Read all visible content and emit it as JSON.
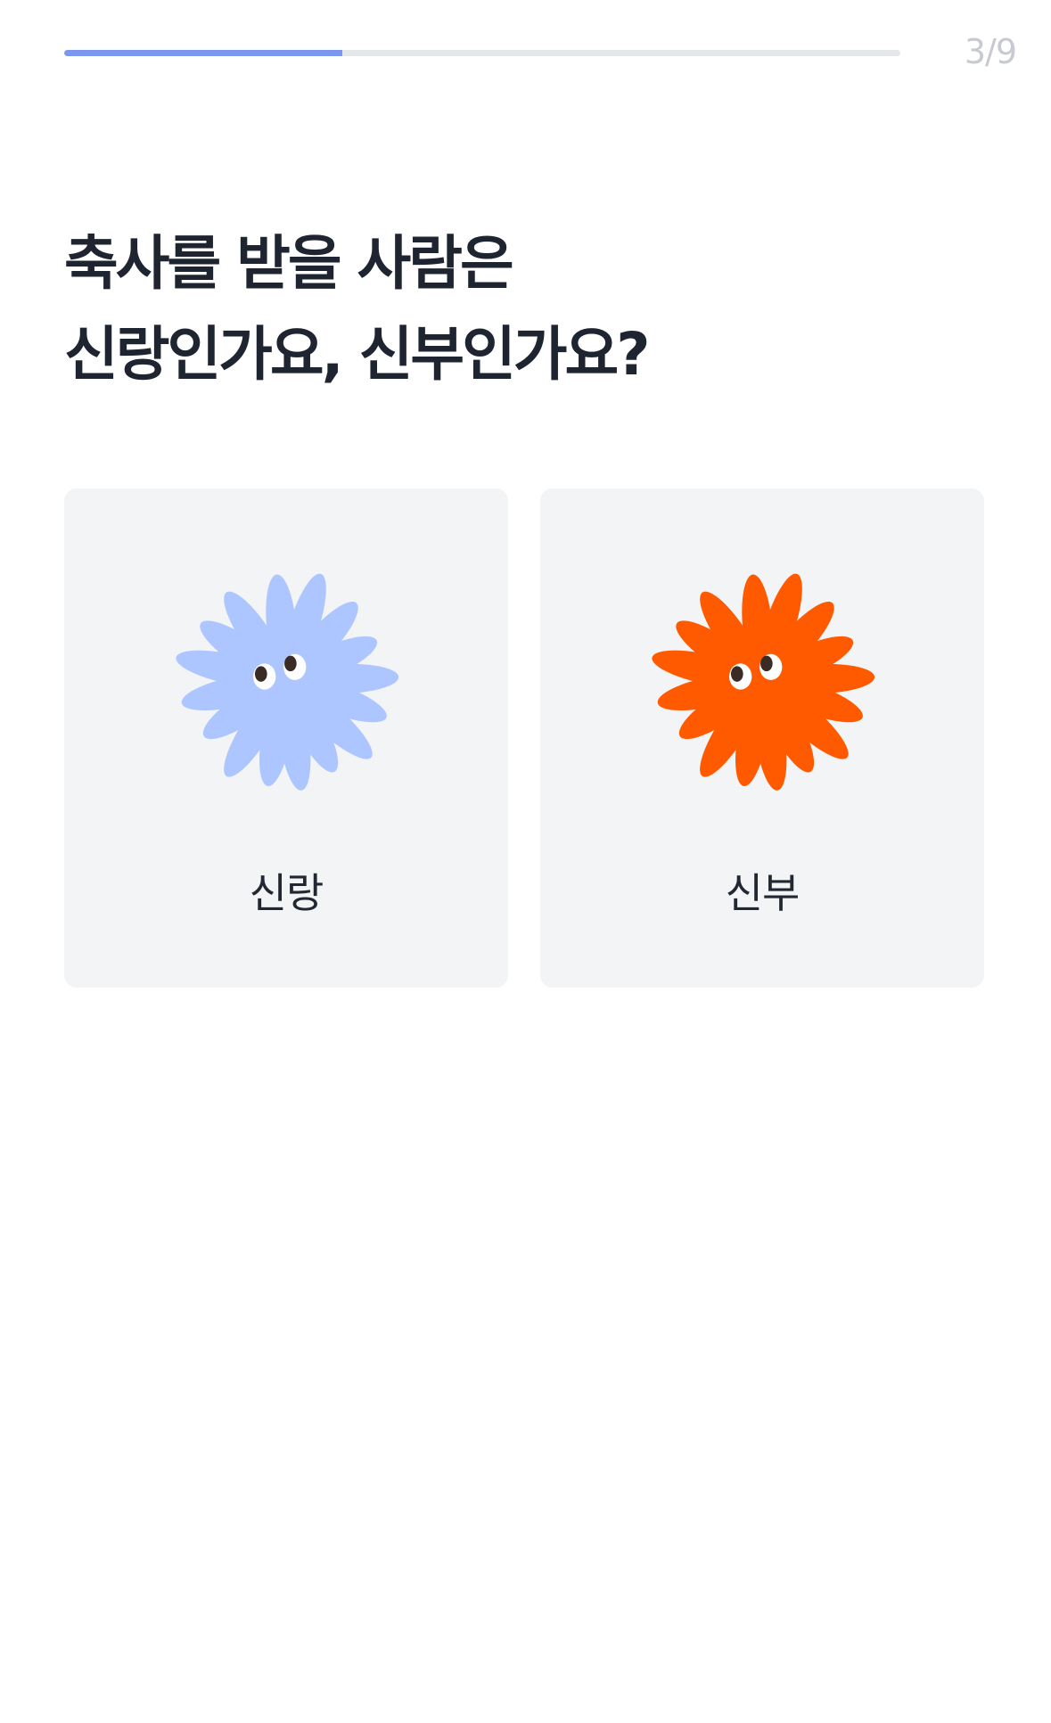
{
  "progress": {
    "current_step": 3,
    "total_steps": 9,
    "label": "3/9",
    "fill_fraction": 0.333,
    "fill_color": "#7b96ef",
    "track_color": "#e5e8eb"
  },
  "question": {
    "line1": "축사를 받을 사람은",
    "line2": "신랑인가요, 신부인가요?"
  },
  "options": [
    {
      "label": "신랑",
      "icon": "blue-flower-mascot-icon",
      "color": "#adc6ff"
    },
    {
      "label": "신부",
      "icon": "orange-flower-mascot-icon",
      "color": "#ff5a00"
    }
  ]
}
